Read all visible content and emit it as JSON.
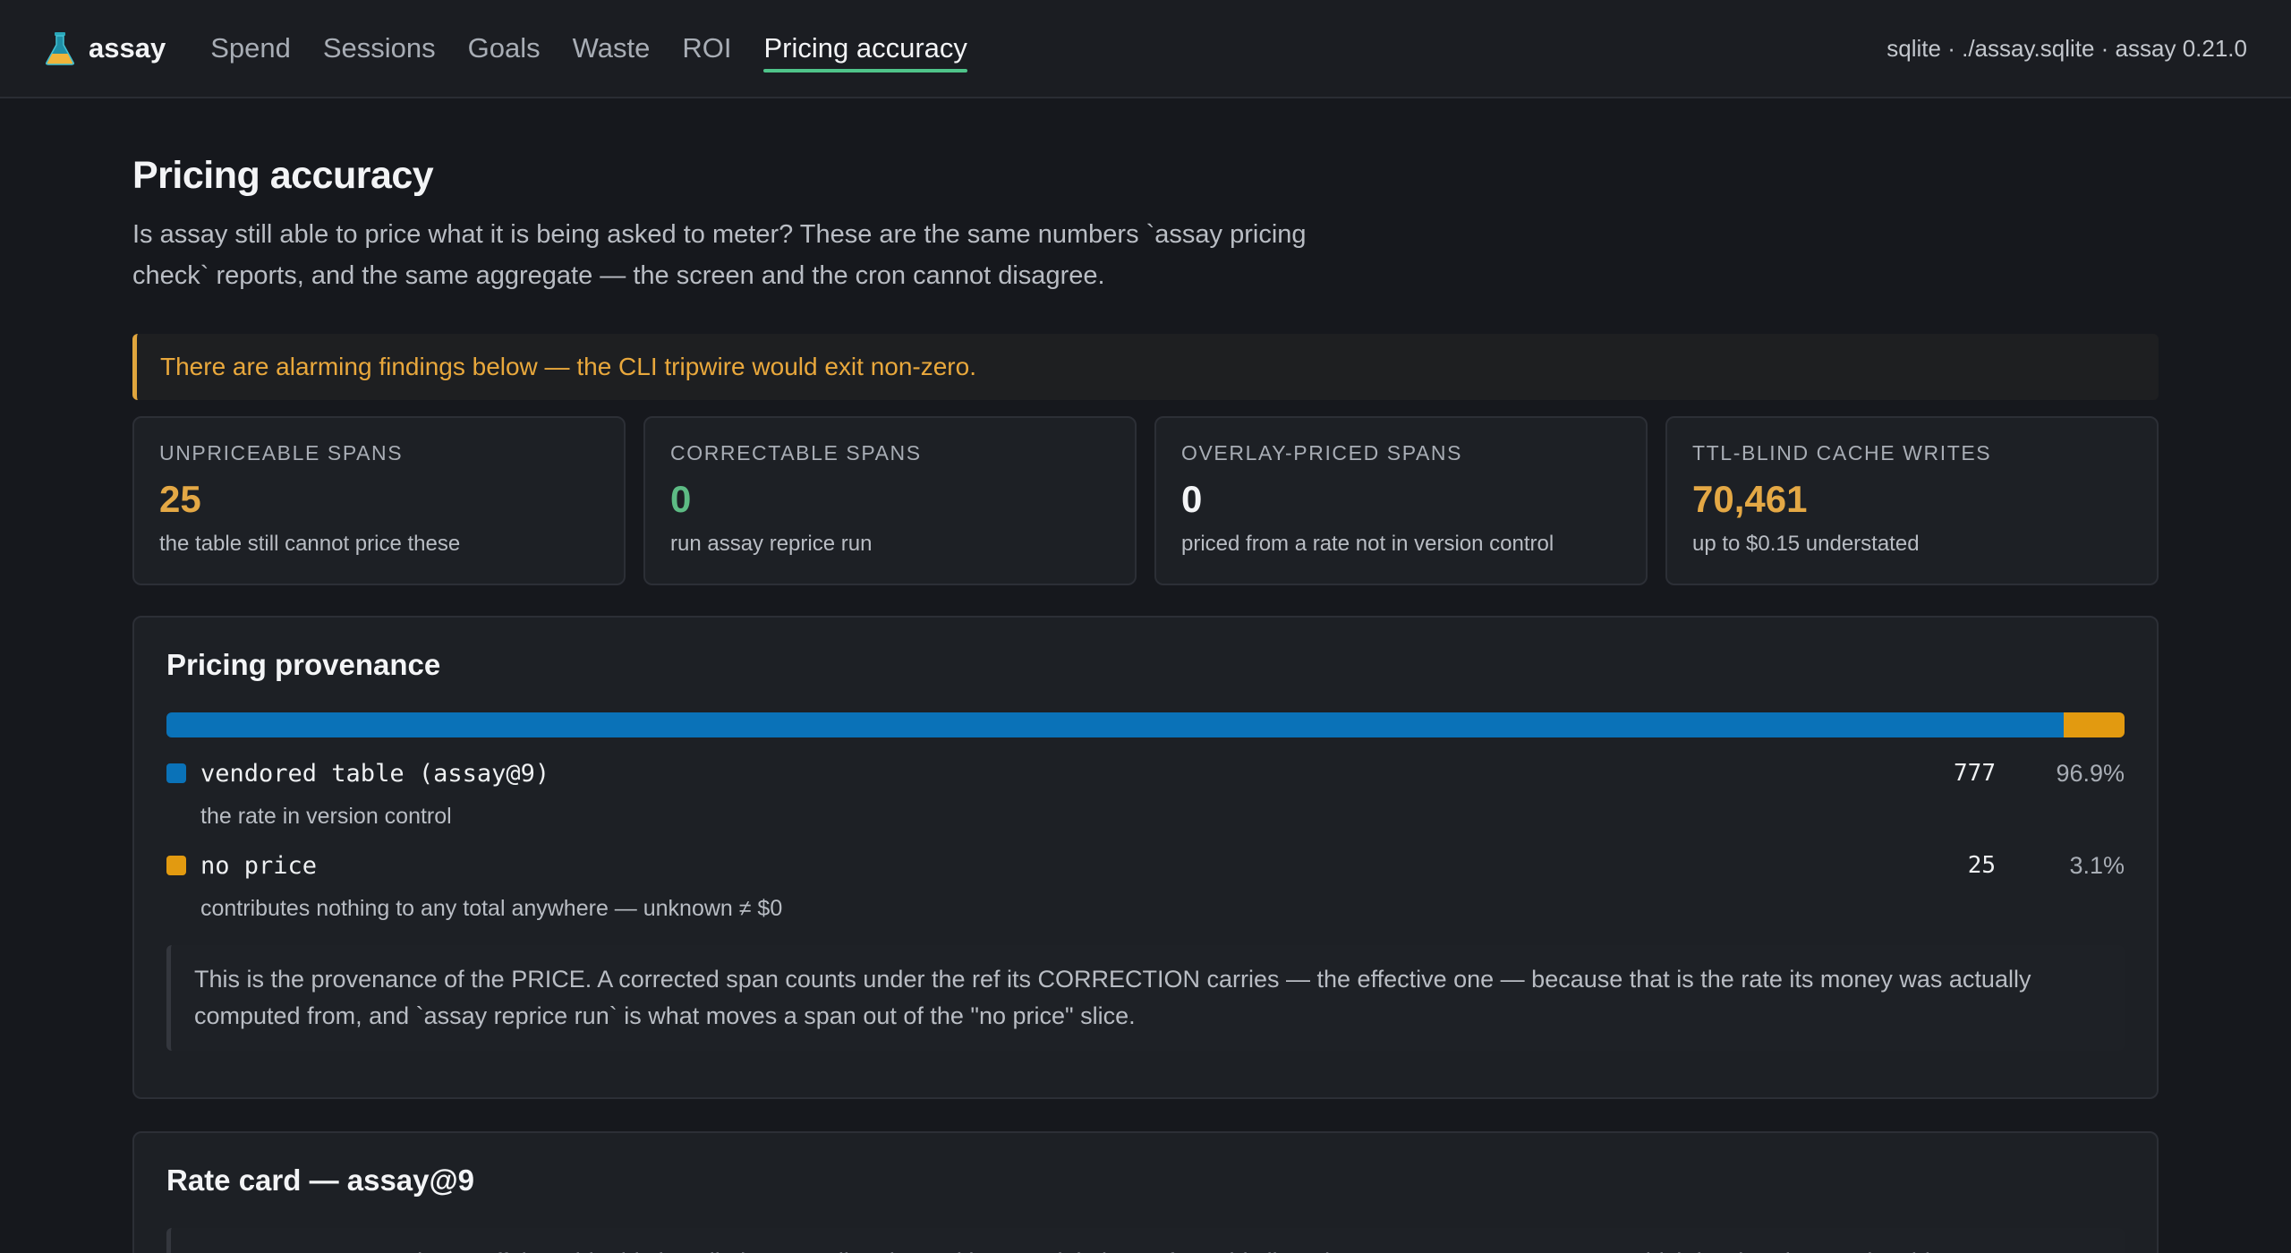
{
  "app": {
    "name": "assay",
    "env": "sqlite · ./assay.sqlite · assay 0.21.0"
  },
  "nav": {
    "items": [
      {
        "label": "Spend",
        "active": false
      },
      {
        "label": "Sessions",
        "active": false
      },
      {
        "label": "Goals",
        "active": false
      },
      {
        "label": "Waste",
        "active": false
      },
      {
        "label": "ROI",
        "active": false
      },
      {
        "label": "Pricing accuracy",
        "active": true
      }
    ]
  },
  "page": {
    "title": "Pricing accuracy",
    "intro": "Is assay still able to price what it is being asked to meter? These are the same numbers `assay pricing check` reports, and the same aggregate — the screen and the cron cannot disagree.",
    "alert": "There are alarming findings below — the CLI tripwire would exit non-zero."
  },
  "stats": [
    {
      "label": "Unpriceable spans",
      "value": "25",
      "note": "the table still cannot price these",
      "tone": "warn"
    },
    {
      "label": "Correctable spans",
      "value": "0",
      "note": "run assay reprice run",
      "tone": "good"
    },
    {
      "label": "Overlay-priced spans",
      "value": "0",
      "note": "priced from a rate not in version control",
      "tone": "neutral"
    },
    {
      "label": "TTL-blind cache writes",
      "value": "70,461",
      "note": "up to $0.15 understated",
      "tone": "warn"
    }
  ],
  "provenance": {
    "title": "Pricing provenance",
    "segments": [
      {
        "name": "vendored table (assay@9)",
        "count": "777",
        "pct": "96.9%",
        "fraction": 0.969,
        "color": "#0a72b8",
        "desc": "the rate in version control"
      },
      {
        "name": "no price",
        "count": "25",
        "pct": "3.1%",
        "fraction": 0.031,
        "color": "#e29a10",
        "desc": "contributes nothing to any total anywhere — unknown ≠ $0"
      }
    ],
    "note": "This is the provenance of the PRICE. A corrected span counts under the ref its CORRECTION carries — the effective one — because that is the rate its money was actually computed from, and `assay reprice run` is what moves a span out of the \"no price\" slice."
  },
  "ratecard": {
    "title": "Rate card — assay@9",
    "note": "USD per MILLION tokens, off the table this installation actually prices with. A model absent from this list prices to NULL, not to zero — which is what the unpriceable"
  }
}
